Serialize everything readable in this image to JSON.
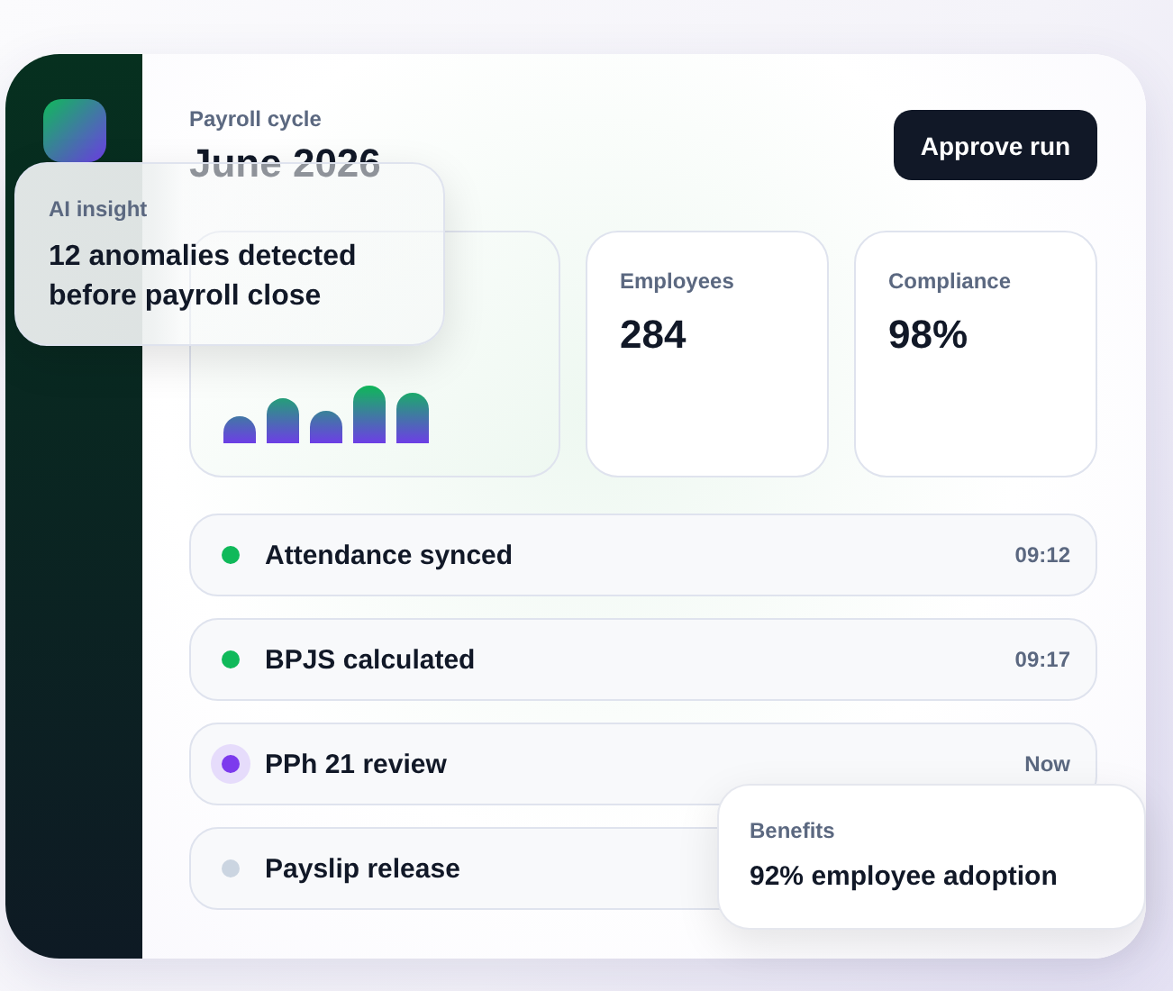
{
  "header": {
    "label": "Payroll cycle",
    "title": "June 2026",
    "button": "Approve run"
  },
  "stats": [
    {
      "label": "Employees",
      "value": "284"
    },
    {
      "label": "Compliance",
      "value": "98%"
    }
  ],
  "steps": [
    {
      "label": "Attendance synced",
      "time": "09:12",
      "kind": "done",
      "color": "#10b95a"
    },
    {
      "label": "BPJS calculated",
      "time": "09:17",
      "kind": "done",
      "color": "#10b95a"
    },
    {
      "label": "PPh 21 review",
      "time": "Now",
      "kind": "active",
      "color": "#7c3aed"
    },
    {
      "label": "Payslip release",
      "kind": "pending",
      "color": "#cbd5e1"
    }
  ],
  "insight": {
    "label": "AI insight",
    "text": "12 anomalies detected before payroll close"
  },
  "benefits": {
    "label": "Benefits",
    "text": "92% employee adoption"
  }
}
